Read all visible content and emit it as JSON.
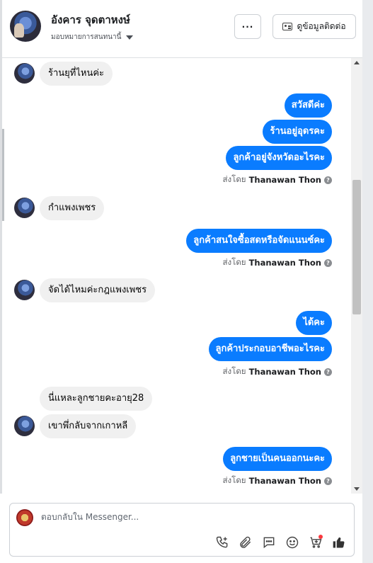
{
  "header": {
    "contact_name": "อังคาร จุดตาหงษ์",
    "assign_label": "มอบหมายการสนทนานี้",
    "more_label": "···",
    "contact_info_label": "ดูข้อมูลติดต่อ"
  },
  "messages": {
    "m1": "ร้านยุที่ไหนค่ะ",
    "m2": "สวัสดีค่ะ",
    "m3": "ร้านอยู่อุดรคะ",
    "m4": "ลูกค้าอยู่จังหวัดอะไรคะ",
    "m5": "กำแพงเพชร",
    "m6": "ลูกค้าสนใจซื้อสดหรือจัดแนนซ์คะ",
    "m7": "จัดได้ไหมค่ะกฎแพงเพชร",
    "m8": "ได้คะ",
    "m9": "ลูกค้าประกอบอาชีพอะไรคะ",
    "m10": "นี่แหละลูกชายคะอายุ28",
    "m11": "เขาพึ่กลับจากเกาหลี",
    "m12": "ลูกชายเป็นคนออกนะคะ"
  },
  "sent_by": {
    "prefix": "ส่งโดย",
    "name": "Thanawan Thon",
    "help": "?"
  },
  "composer": {
    "placeholder": "ตอบกลับใน Messenger..."
  },
  "colors": {
    "outgoing_bubble": "#0a7cff",
    "incoming_bubble": "#f0f0f0"
  }
}
